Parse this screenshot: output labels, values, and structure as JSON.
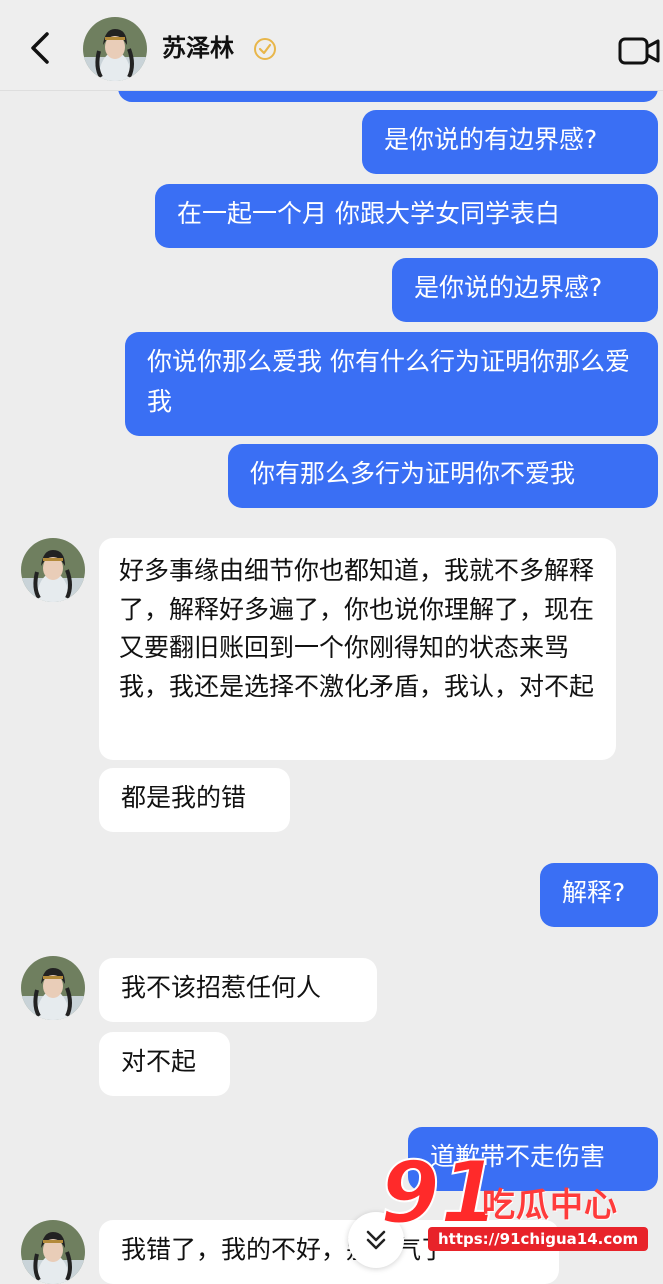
{
  "header": {
    "title": "苏泽林"
  },
  "messages": {
    "m0": "",
    "m1": "是你说的有边界感?",
    "m2": "在一起一个月  你跟大学女同学表白",
    "m3": "是你说的边界感?",
    "m4": "你说你那么爱我  你有什么行为证明你那么爱我",
    "m5": "你有那么多行为证明你不爱我",
    "m6": "好多事缘由细节你也都知道，我就不多解释了，解释好多遍了，你也说你理解了，现在又要翻旧账回到一个你刚得知的状态来骂我，我还是选择不激化矛盾，我认，对不起",
    "m7": "都是我的错",
    "m8": "解释?",
    "m9": "我不该招惹任何人",
    "m10": "对不起",
    "m11": "道歉带不走伤害",
    "m12": "我错了，我的不好，别生气了"
  },
  "watermark": {
    "number": "91",
    "text": "吃瓜中心",
    "url": "https://91chigua14.com"
  },
  "colors": {
    "sent_bubble": "#3a6ff4",
    "received_bubble": "#ffffff",
    "background": "#ededed"
  },
  "icons": [
    "back-arrow-icon",
    "verified-badge-icon",
    "video-call-icon",
    "scroll-down-icon"
  ]
}
